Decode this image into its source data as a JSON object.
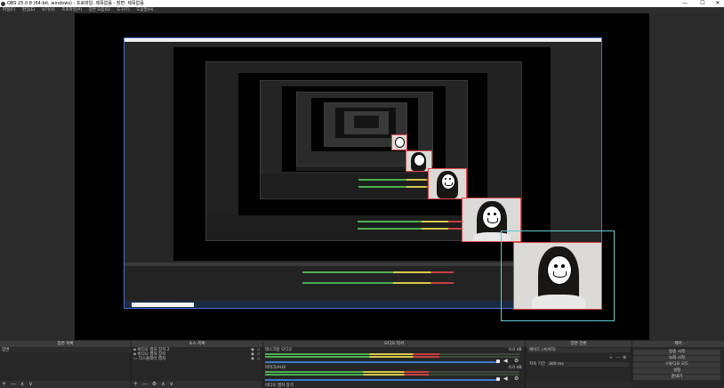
{
  "window": {
    "title": "OBS 25.0.8 (64-bit, windows) - 프로파일: 제목없음 - 장면: 제목없음",
    "minimize": "—",
    "maximize": "☐",
    "close": "✕"
  },
  "menu": [
    "파일(F)",
    "편집(E)",
    "보기(V)",
    "프로파일(P)",
    "장면 모음(S)",
    "도구(T)",
    "도움말(H)"
  ],
  "docks": {
    "scenes": {
      "title": "장면 목록",
      "items": [
        "장면"
      ],
      "footer": [
        "+",
        "—",
        "∧",
        "∨"
      ]
    },
    "sources": {
      "title": "소스 목록",
      "items": [
        "비디오 캡처 장치 2",
        "비디오 캡처 장치",
        "디스플레이 캡처"
      ],
      "footer": [
        "+",
        "—",
        "⚙",
        "∧",
        "∨"
      ]
    },
    "mixer": {
      "title": "오디오 믹서",
      "channels": [
        {
          "name": "데스크탑 오디오",
          "db": "0.0 dB"
        },
        {
          "name": "마이크/AUX",
          "db": "0.0 dB"
        },
        {
          "name": "비디오 캡처 장치"
        }
      ]
    },
    "transitions": {
      "title": "장면 전환",
      "type": "페이드 (서서히)",
      "duration_label": "지속 기간",
      "duration_value": "300 ms",
      "footer": [
        "+",
        "—",
        "⚙"
      ]
    },
    "controls": {
      "title": "제어",
      "buttons": [
        "방송 시작",
        "녹화 시작",
        "스튜디오 모드",
        "설정",
        "끝내기"
      ]
    }
  },
  "colors": {
    "selection": "#5ccbd0",
    "source_border": "#e04848",
    "meter_green": "#4caf50",
    "meter_yellow": "#d8c84a"
  }
}
